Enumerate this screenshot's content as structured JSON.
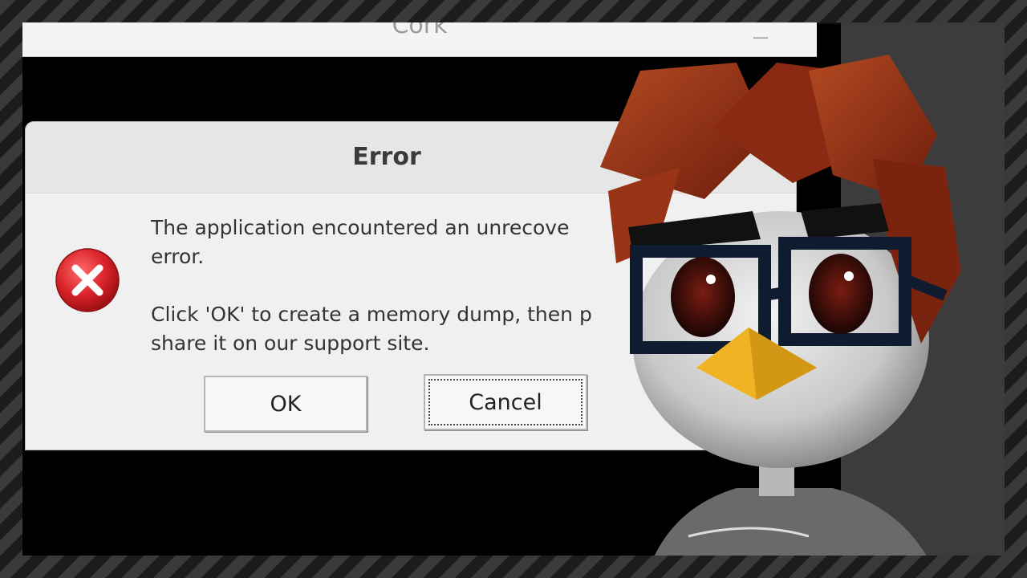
{
  "main_window": {
    "title": "Cork",
    "minimize_glyph": "—"
  },
  "dialog": {
    "title": "Error",
    "icon": "error-x-icon",
    "message_line1": "The application encountered an unrecove",
    "message_line2": "error.",
    "message_line3": "Click 'OK' to create a memory dump, then p",
    "message_line4": "share it on our support site.",
    "ok_label": "OK",
    "cancel_label": "Cancel"
  },
  "colors": {
    "error_red": "#d9232a",
    "hair": "#8a2a12",
    "beak": "#f0b323"
  }
}
